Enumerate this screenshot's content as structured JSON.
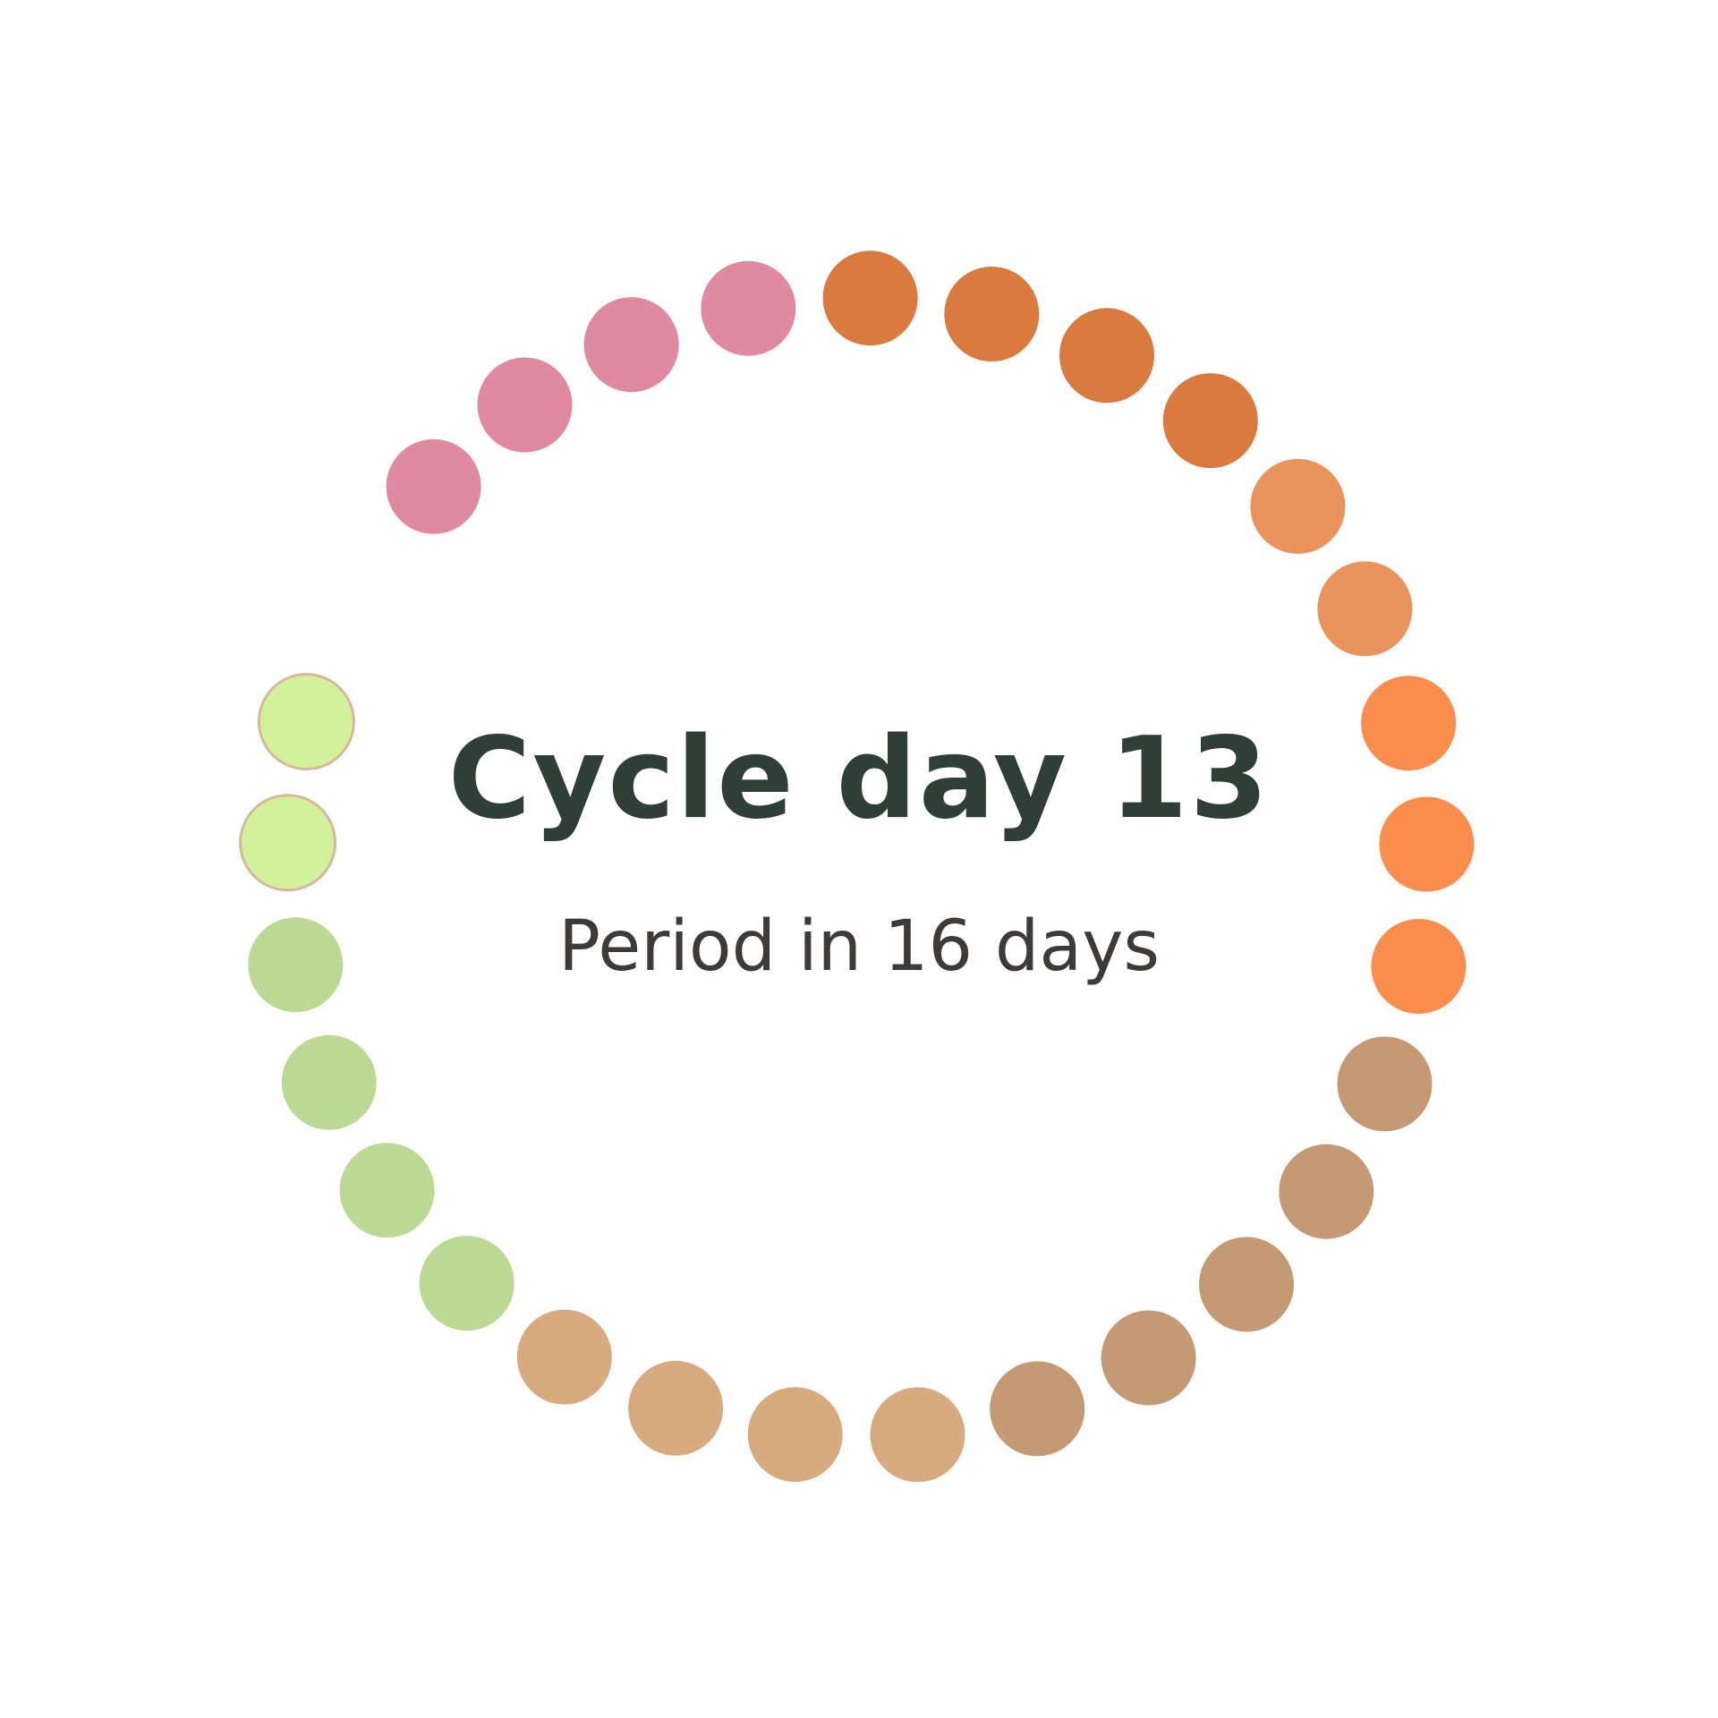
{
  "cycle": {
    "day_label": "Cycle day 13",
    "period_label": "Period in 16 days",
    "current_day": 13,
    "days_until_period": 16
  },
  "ring": {
    "dots": [
      {
        "day": 1,
        "color": "#e08aa0",
        "phase": "period"
      },
      {
        "day": 2,
        "color": "#e08aa0",
        "phase": "period"
      },
      {
        "day": 3,
        "color": "#e08aa0",
        "phase": "period"
      },
      {
        "day": 4,
        "color": "#e08aa0",
        "phase": "period"
      },
      {
        "day": 5,
        "color": "#d97a3f",
        "phase": "dark-orange"
      },
      {
        "day": 6,
        "color": "#d97a3f",
        "phase": "dark-orange"
      },
      {
        "day": 7,
        "color": "#d97a3f",
        "phase": "dark-orange"
      },
      {
        "day": 8,
        "color": "#d97a3f",
        "phase": "dark-orange"
      },
      {
        "day": 9,
        "color": "#eb935c",
        "phase": "light-orange"
      },
      {
        "day": 10,
        "color": "#eb935c",
        "phase": "light-orange"
      },
      {
        "day": 11,
        "color": "#fb8d4e",
        "phase": "bright-orange"
      },
      {
        "day": 12,
        "color": "#fb8d4e",
        "phase": "bright-orange"
      },
      {
        "day": 13,
        "color": "#fb8d4e",
        "phase": "bright-orange"
      },
      {
        "day": 14,
        "color": "#c49a74",
        "phase": "brown"
      },
      {
        "day": 15,
        "color": "#c49a74",
        "phase": "brown"
      },
      {
        "day": 16,
        "color": "#c49a74",
        "phase": "brown"
      },
      {
        "day": 17,
        "color": "#c49a74",
        "phase": "brown"
      },
      {
        "day": 18,
        "color": "#c49a74",
        "phase": "brown"
      },
      {
        "day": 19,
        "color": "#d7aa80",
        "phase": "tan"
      },
      {
        "day": 20,
        "color": "#d7aa80",
        "phase": "tan"
      },
      {
        "day": 21,
        "color": "#d7aa80",
        "phase": "tan"
      },
      {
        "day": 22,
        "color": "#d7aa80",
        "phase": "tan"
      },
      {
        "day": 23,
        "color": "#bcd895",
        "phase": "green"
      },
      {
        "day": 24,
        "color": "#bcd895",
        "phase": "green"
      },
      {
        "day": 25,
        "color": "#bcd895",
        "phase": "green"
      },
      {
        "day": 26,
        "color": "#bcd895",
        "phase": "green"
      },
      {
        "day": 27,
        "color": "#d3f09a",
        "phase": "light-green"
      },
      {
        "day": 28,
        "color": "#d3f09a",
        "phase": "light-green"
      }
    ]
  },
  "colors": {
    "title": "#2f3f38",
    "subtitle": "#3e3a38",
    "background": "#ffffff",
    "light_green_outline": "#d8b89c"
  }
}
